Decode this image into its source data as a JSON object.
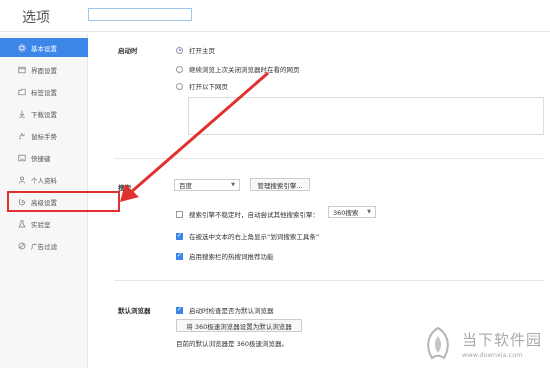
{
  "header": {
    "title": "选项",
    "search_placeholder": ""
  },
  "sidebar": {
    "items": [
      {
        "label": "基本设置",
        "icon": "gear-icon",
        "active": true
      },
      {
        "label": "界面设置",
        "icon": "window-icon"
      },
      {
        "label": "标签设置",
        "icon": "tag-icon"
      },
      {
        "label": "下载设置",
        "icon": "download-icon"
      },
      {
        "label": "鼠标手势",
        "icon": "mouse-gesture-icon"
      },
      {
        "label": "快捷键",
        "icon": "keyboard-icon"
      },
      {
        "label": "个人资料",
        "icon": "user-icon"
      },
      {
        "label": "高级设置",
        "icon": "advanced-icon"
      },
      {
        "label": "实验室",
        "icon": "lab-icon"
      },
      {
        "label": "广告过滤",
        "icon": "block-icon"
      }
    ]
  },
  "startup": {
    "label": "启动时",
    "options": [
      {
        "label": "打开主页",
        "checked": true
      },
      {
        "label": "继续浏览上次关闭浏览器时在看的网页",
        "checked": false
      },
      {
        "label": "打开以下网页",
        "checked": false
      }
    ]
  },
  "search": {
    "label": "搜索",
    "engine": "百度",
    "manage_button": "管理搜索引擎...",
    "fallback_check": "搜索引擎不稳定时，自动尝试其他搜索引擎：",
    "fallback_engine": "360搜索",
    "fallback_checked": false,
    "option_toolbar": "在被选中文本的右上角显示“划词搜索工具条”",
    "option_toolbar_checked": true,
    "option_hot": "启用搜索栏的热搜词推荐功能",
    "option_hot_checked": true
  },
  "default_browser": {
    "label": "默认浏览器",
    "check_label": "启动时检查是否为默认浏览器",
    "check_checked": true,
    "set_button": "将 360极速浏览器设置为默认浏览器",
    "status_text": "目前的默认浏览器是 360极速浏览器。"
  },
  "watermark": {
    "main": "当下软件园",
    "sub": "www.downxia.com"
  },
  "colors": {
    "accent": "#3c86e8",
    "annotation": "#e0312f"
  }
}
